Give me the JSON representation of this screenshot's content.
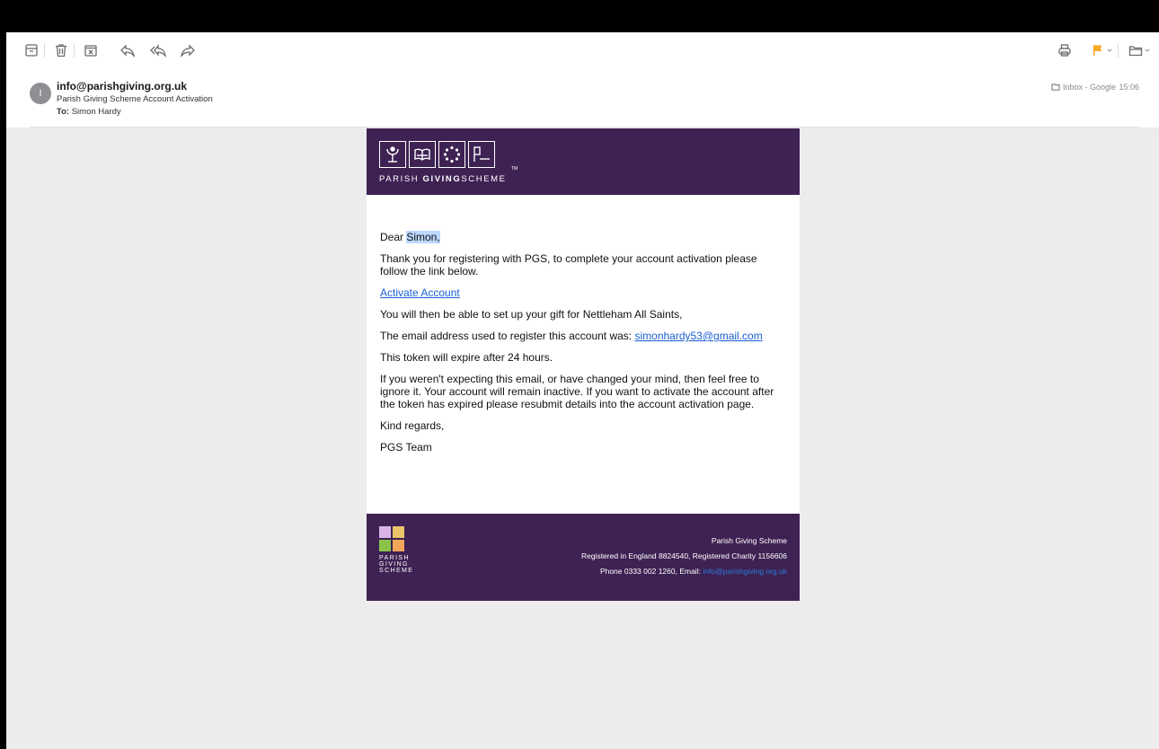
{
  "toolbar": {
    "icons": [
      "archive-icon",
      "trash-icon",
      "junk-icon",
      "reply-icon",
      "reply-all-icon",
      "forward-icon",
      "print-icon",
      "flag-icon",
      "move-icon"
    ]
  },
  "header": {
    "avatar_initial": "I",
    "from": "info@parishgiving.org.uk",
    "subject": "Parish Giving Scheme Account Activation",
    "to_label": "To:",
    "to_name": "Simon Hardy",
    "mailbox": "Inbox - Google",
    "time": "15:06"
  },
  "email": {
    "logo": {
      "parish": "PARISH ",
      "giving": "GIVING",
      "scheme": "SCHEME",
      "tm": "TM"
    },
    "greeting_prefix": "Dear ",
    "greeting_name": "Simon,",
    "para1": "Thank you for registering with PGS, to complete your account activation please follow the link below.",
    "activate_link": "Activate Account",
    "para2": "You will then be able to set up your gift for Nettleham All Saints,",
    "para3_prefix": "The email address used to register this account was: ",
    "registered_email": "simonhardy53@gmail.com",
    "para4": "This token will expire after 24 hours.",
    "para5": "If you weren't expecting this email, or have changed your mind, then feel free to ignore it. Your account will remain inactive. If you want to activate the account after the token has expired please resubmit details into the account activation page.",
    "signoff": "Kind regards,",
    "team": "PGS Team"
  },
  "footer": {
    "logo_parish": "PARISH",
    "logo_giving": "GIVING",
    "logo_scheme": "SCHEME",
    "org": "Parish Giving Scheme",
    "registration": "Registered in England 8824540, Registered Charity 1156606",
    "contact_prefix": "Phone 0333 002 1260, Email: ",
    "contact_email": "info@parishgiving.org.uk"
  },
  "colors": {
    "brand_purple": "#3e2254",
    "flag": "#f5a623",
    "link": "#1a5fd4"
  }
}
